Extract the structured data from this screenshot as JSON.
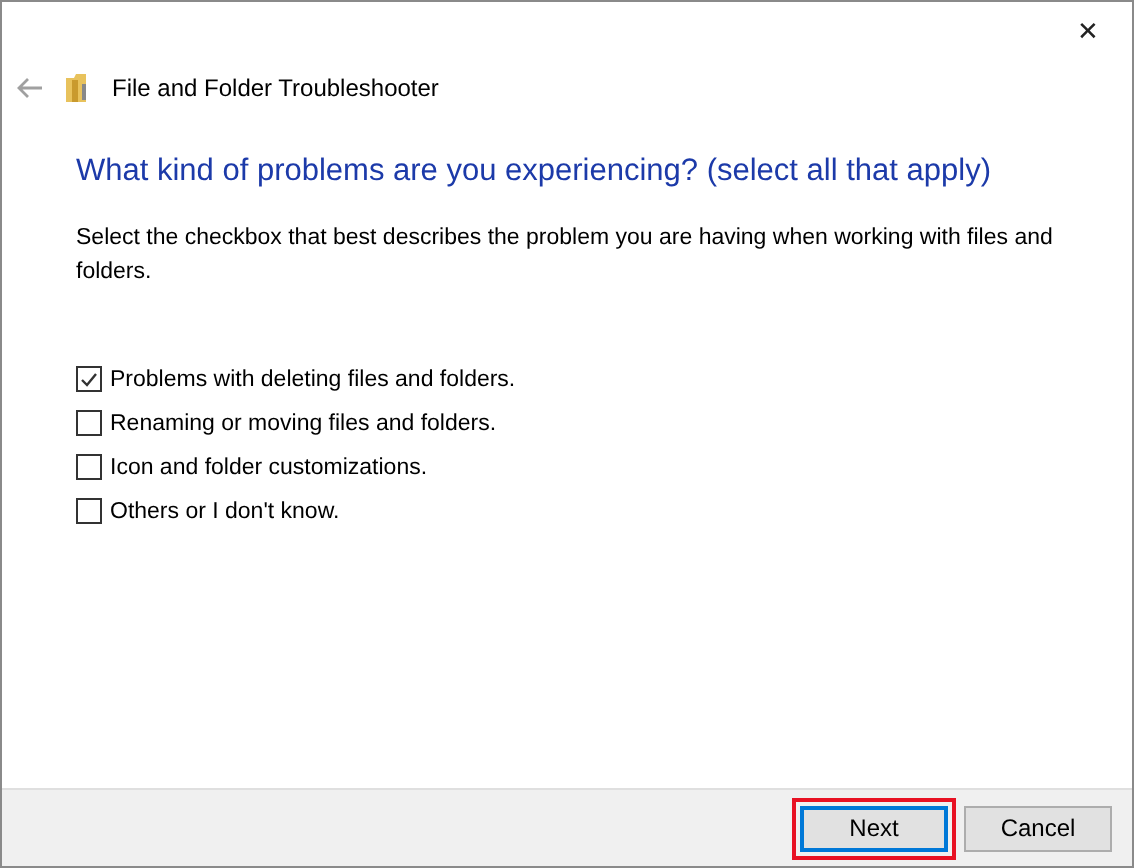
{
  "window": {
    "close_glyph": "✕",
    "title": "File and Folder Troubleshooter"
  },
  "heading": "What kind of problems are you experiencing? (select all that apply)",
  "description": "Select the checkbox that best describes the problem you are having when working with files and folders.",
  "options": [
    {
      "label": "Problems with deleting files and folders.",
      "checked": true
    },
    {
      "label": "Renaming or moving files and folders.",
      "checked": false
    },
    {
      "label": "Icon and folder customizations.",
      "checked": false
    },
    {
      "label": "Others or I don't know.",
      "checked": false
    }
  ],
  "buttons": [
    {
      "label": "Next",
      "kind": "default",
      "highlighted": true
    },
    {
      "label": "Cancel",
      "kind": "normal",
      "highlighted": false
    }
  ]
}
